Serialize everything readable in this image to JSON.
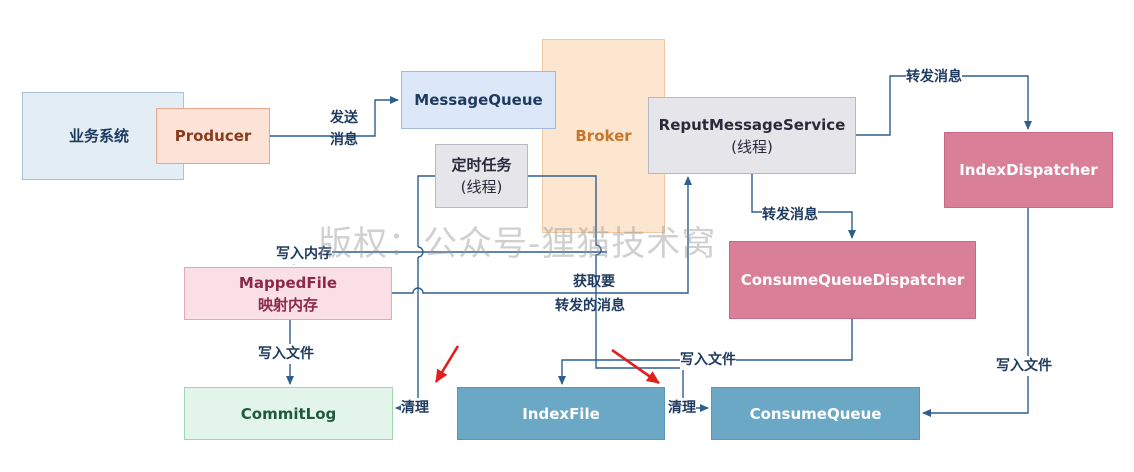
{
  "nodes": {
    "business_system": "业务系统",
    "producer": "Producer",
    "message_queue": "MessageQueue",
    "broker": "Broker",
    "reput_service": {
      "line1": "ReputMessageService",
      "line2": "(线程)"
    },
    "index_dispatcher": "IndexDispatcher",
    "timer_task": {
      "line1": "定时任务",
      "line2": "(线程)"
    },
    "mapped_file": {
      "line1": "MappedFile",
      "line2": "映射内存"
    },
    "consume_queue_dispatcher": "ConsumeQueueDispatcher",
    "commit_log": "CommitLog",
    "index_file": "IndexFile",
    "consume_queue": "ConsumeQueue"
  },
  "labels": {
    "send_msg_1": "发送",
    "send_msg_2": "消息",
    "forward_msg_top": "转发消息",
    "forward_msg_mid": "转发消息",
    "write_memory": "写入内存",
    "fetch_1": "获取要",
    "fetch_2": "转发的消息",
    "write_file_left": "写入文件",
    "write_file_mid": "写入文件",
    "write_file_right": "写入文件",
    "clean_left": "清理",
    "clean_right": "清理"
  },
  "watermark": "版权：公众号-狸猫技术窝",
  "colors": {
    "arrow": "#2f5f8f",
    "red_arrow": "#e02020"
  }
}
